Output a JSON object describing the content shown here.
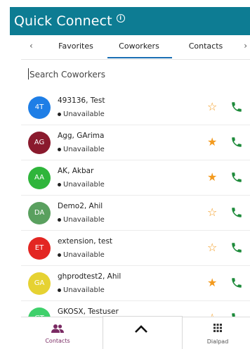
{
  "header": {
    "title": "Quick Connect"
  },
  "tabs": {
    "left_arrow": "‹",
    "right_arrow": "›",
    "items": [
      "Favorites",
      "Coworkers",
      "Contacts"
    ],
    "active": "Coworkers"
  },
  "search": {
    "placeholder": "Search Coworkers"
  },
  "contacts": [
    {
      "initials": "4T",
      "name": "493136, Test",
      "status": "Unavailable",
      "color": "#1e7ee6",
      "favorite": false
    },
    {
      "initials": "AG",
      "name": "Agg, GArima",
      "status": "Unavailable",
      "color": "#8a1a2d",
      "favorite": true
    },
    {
      "initials": "AA",
      "name": "AK, Akbar",
      "status": "Unavailable",
      "color": "#2fb53b",
      "favorite": true
    },
    {
      "initials": "DA",
      "name": "Demo2, Ahil",
      "status": "Unavailable",
      "color": "#5aa05f",
      "favorite": false
    },
    {
      "initials": "ET",
      "name": "extension, test",
      "status": "Unavailable",
      "color": "#e32622",
      "favorite": false
    },
    {
      "initials": "GA",
      "name": "ghprodtest2, Ahil",
      "status": "Unavailable",
      "color": "#e6d232",
      "favorite": true
    },
    {
      "initials": "GT",
      "name": "GKOSX, Testuser",
      "status": "",
      "color": "#3fd06b",
      "favorite": false
    }
  ],
  "bottom_nav": {
    "contacts_label": "Contacts",
    "dialpad_label": "Dialpad"
  },
  "colors": {
    "header": "#0d7c93",
    "star": "#f39a1e",
    "phone": "#1d8a3a",
    "active_tab": "#1b6fb4"
  }
}
